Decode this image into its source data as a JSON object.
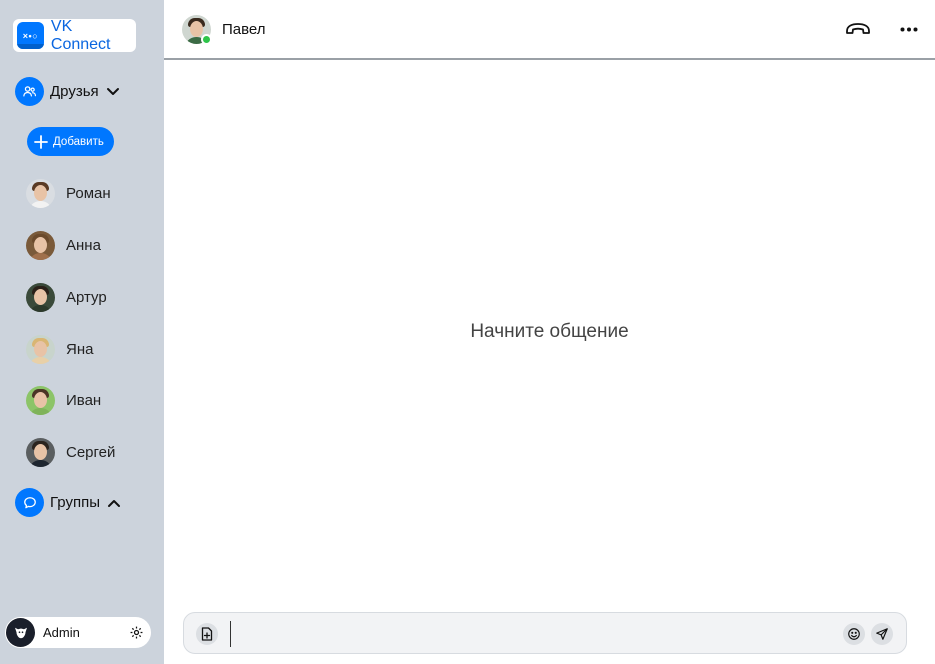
{
  "app": {
    "logo_text": "VK Connect",
    "logo_mark": "×•○"
  },
  "sidebar": {
    "friends_section": {
      "label": "Друзья",
      "expanded": true
    },
    "add_button": {
      "label": "Добавить"
    },
    "friends": [
      {
        "name": "Роман",
        "hair": "#5a3a24",
        "shirt": "#f2f2f2",
        "bg": "#d9dde2"
      },
      {
        "name": "Анна",
        "hair": "#6b4a2c",
        "shirt": "#a0704c",
        "bg": "#7a5a3a"
      },
      {
        "name": "Артур",
        "hair": "#2a2018",
        "shirt": "#2c3a2c",
        "bg": "#3a4a3a"
      },
      {
        "name": "Яна",
        "hair": "#d9b673",
        "shirt": "#e8d0a8",
        "bg": "#c8d4cc"
      },
      {
        "name": "Иван",
        "hair": "#4a3526",
        "shirt": "#7fb35a",
        "bg": "#8cc468"
      },
      {
        "name": "Сергей",
        "hair": "#2b241e",
        "shirt": "#1e2630",
        "bg": "#5a5e60"
      }
    ],
    "groups_section": {
      "label": "Группы",
      "expanded": false
    },
    "user": {
      "name": "Admin"
    }
  },
  "chat": {
    "contact_name": "Павел",
    "contact_online": true,
    "empty_state": "Начните общение",
    "input": {
      "value": "",
      "placeholder": ""
    }
  },
  "colors": {
    "accent": "#0077ff",
    "sidebar_bg": "#ccd3dc",
    "online": "#2ec44a"
  }
}
